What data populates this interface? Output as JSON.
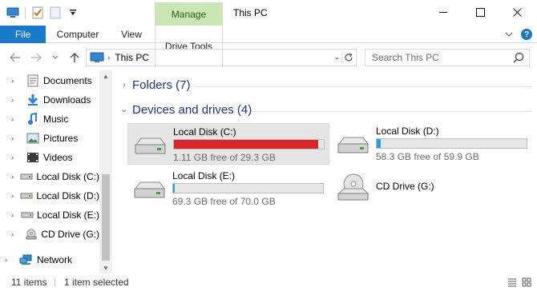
{
  "window": {
    "title": "This PC",
    "context_tab": "Manage",
    "controls": {
      "minimize": "—",
      "maximize": "☐",
      "close": "✕"
    }
  },
  "ribbon": {
    "tabs": [
      {
        "label": "File"
      },
      {
        "label": "Computer"
      },
      {
        "label": "View"
      },
      {
        "label": "Drive Tools"
      }
    ],
    "help": "?",
    "collapse": "⌄"
  },
  "address": {
    "location": "This PC",
    "search_placeholder": "Search This PC"
  },
  "nav_pane": {
    "items": [
      {
        "label": "Documents",
        "icon": "documents-icon"
      },
      {
        "label": "Downloads",
        "icon": "downloads-icon"
      },
      {
        "label": "Music",
        "icon": "music-icon"
      },
      {
        "label": "Pictures",
        "icon": "pictures-icon"
      },
      {
        "label": "Videos",
        "icon": "videos-icon"
      },
      {
        "label": "Local Disk (C:)",
        "icon": "drive-icon"
      },
      {
        "label": "Local Disk (D:)",
        "icon": "drive-icon"
      },
      {
        "label": "Local Disk (E:)",
        "icon": "drive-icon"
      },
      {
        "label": "CD Drive (G:)",
        "icon": "cd-drive-icon"
      },
      {
        "label": "Network",
        "icon": "network-icon"
      }
    ]
  },
  "content": {
    "folders_header": "Folders (7)",
    "devices_header": "Devices and drives (4)",
    "drives": [
      {
        "name": "Local Disk (C:)",
        "free_text": "1.11 GB free of 29.3 GB",
        "used_fraction": 0.962,
        "bar_color": "#da2626",
        "selected": true
      },
      {
        "name": "Local Disk (D:)",
        "free_text": "58.3 GB free of 59.9 GB",
        "used_fraction": 0.027,
        "bar_color": "#26a0da",
        "selected": false
      },
      {
        "name": "Local Disk (E:)",
        "free_text": "69.3 GB free of 70.0 GB",
        "used_fraction": 0.01,
        "bar_color": "#26a0da",
        "selected": false
      },
      {
        "name": "CD Drive (G:)",
        "free_text": "",
        "selected": false
      }
    ]
  },
  "status": {
    "item_count": "11 items",
    "selection": "1 item selected"
  },
  "colors": {
    "accent": "#1979ca",
    "manage_tab": "#c9e6b4",
    "header_text": "#1e3287"
  }
}
